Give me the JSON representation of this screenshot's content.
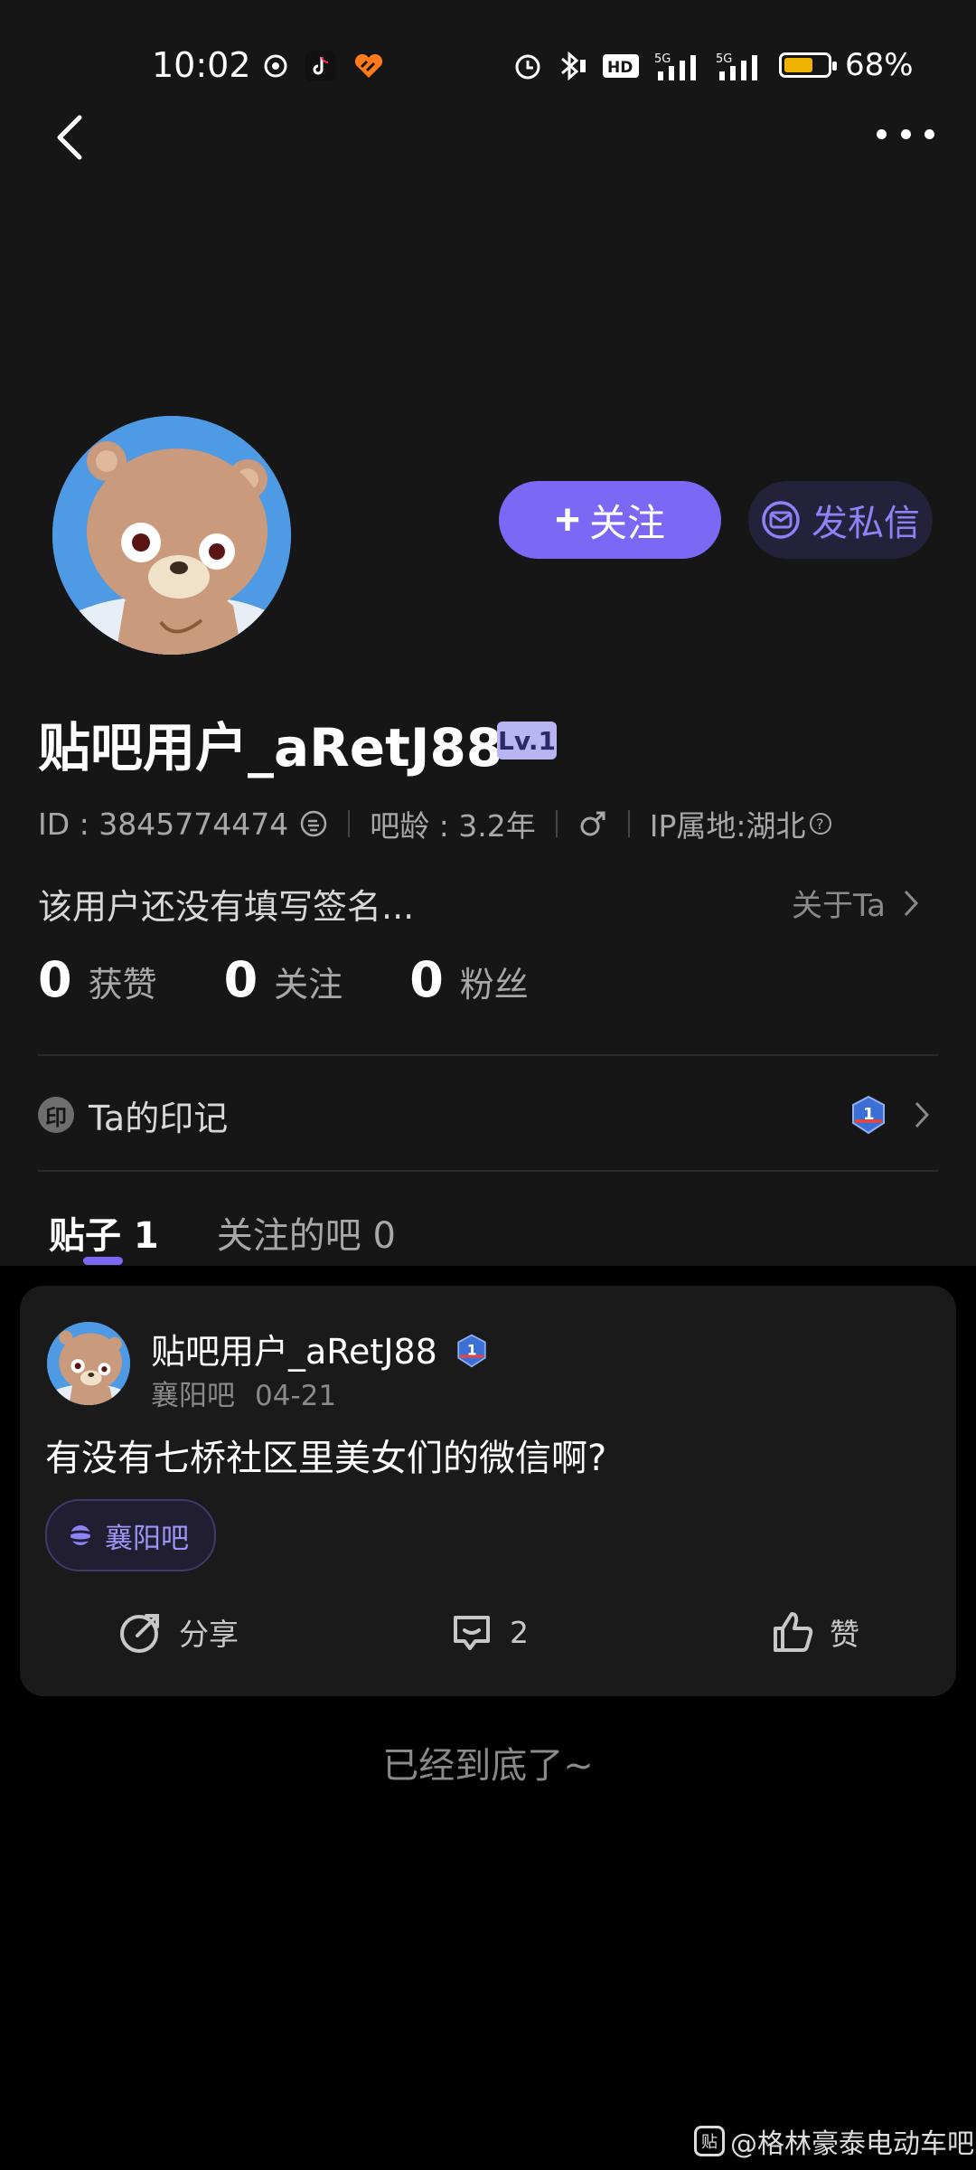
{
  "status_bar": {
    "time": "10:02",
    "battery_text": "68%",
    "battery_level": 0.68,
    "icons": [
      "netease-music-icon",
      "tiktok-icon",
      "app-heart-icon",
      "alarm-icon",
      "bluetooth-icon",
      "hd-icon",
      "signal-5g-icon",
      "signal-5g-icon-2"
    ]
  },
  "nav": {
    "back_icon": "chevron-left-icon",
    "more_icon": "more-dots-icon"
  },
  "profile": {
    "follow_label": "关注",
    "message_label": "发私信",
    "username": "贴吧用户_aRetJ88",
    "level": "Lv.1",
    "id_text": "ID : 3845774474",
    "age_text": "吧龄 : 3.2年",
    "gender_icon": "male-icon",
    "ip_text": "IP属地:湖北",
    "signature": "该用户还没有填写签名...",
    "about_label": "关于Ta",
    "stats": [
      {
        "num": "0",
        "label": "获赞"
      },
      {
        "num": "0",
        "label": "关注"
      },
      {
        "num": "0",
        "label": "粉丝"
      }
    ],
    "marks_stamp": "印",
    "marks_label": "Ta的印记",
    "badge_number": "1"
  },
  "tabs": {
    "posts": "贴子 1",
    "followed_bars": "关注的吧 0"
  },
  "post": {
    "author": "贴吧用户_aRetJ88",
    "forum": "襄阳吧",
    "date": "04-21",
    "title": "有没有七桥社区里美女们的微信啊?",
    "forum_tag": "襄阳吧",
    "share_label": "分享",
    "comment_count": "2",
    "like_label": "赞"
  },
  "end_text": "已经到底了~",
  "watermark": {
    "logo": "贴",
    "text": "@格林豪泰电动车吧"
  },
  "colors": {
    "accent": "#7b68f5",
    "background_top": "#161616",
    "card": "#1a1a1a",
    "battery": "#f0b400"
  }
}
